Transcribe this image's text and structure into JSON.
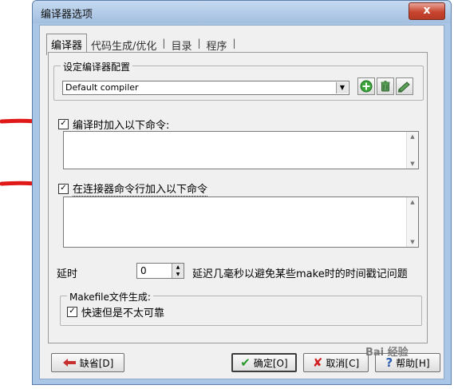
{
  "window": {
    "title": "编译器选项",
    "close_glyph": "x"
  },
  "tabs": [
    {
      "label": "编译器",
      "active": true
    },
    {
      "label": "代码生成/优化",
      "active": false
    },
    {
      "label": "目录",
      "active": false
    },
    {
      "label": "程序",
      "active": false
    }
  ],
  "tab_separator": "|",
  "compiler_config": {
    "legend": "设定编译器配置",
    "selected": "Default compiler",
    "buttons": [
      "add-icon",
      "delete-icon",
      "rename-icon"
    ]
  },
  "compile_cmd": {
    "checked": true,
    "check_glyph": "✓",
    "label": "编译时加入以下命令:",
    "value": ""
  },
  "linker_cmd": {
    "checked": true,
    "check_glyph": "✓",
    "label": "在连接器命令行加入以下命令",
    "value": ""
  },
  "delay": {
    "label": "延时",
    "value": "0",
    "description": "延迟几毫秒以避免某些make时的时间戳记问题"
  },
  "makefile": {
    "legend": "Makefile文件生成:",
    "option_label": "快速但是不太可靠",
    "option_checked": true
  },
  "footer": {
    "default_label": "缺省[D]",
    "ok_label": "确定[O]",
    "cancel_label": "取消[C]",
    "help_label": "帮助[H]"
  },
  "watermark": "Bai 经验",
  "colors": {
    "arrow": "#e01818",
    "close": "#c8452f",
    "ok_check": "#2a9a2a",
    "cancel_x": "#d02020",
    "help": "#2a5fb0"
  }
}
